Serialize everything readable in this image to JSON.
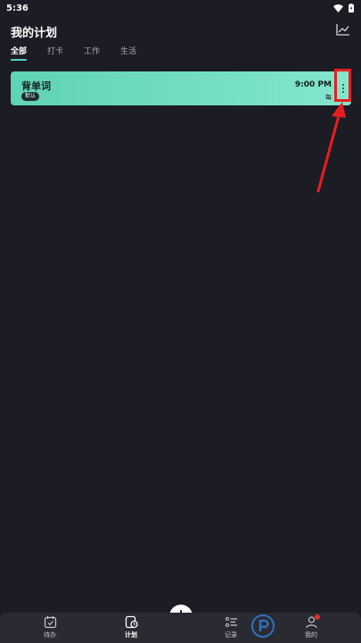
{
  "status_bar": {
    "time": "5:36"
  },
  "header": {
    "title": "我的计划"
  },
  "tabs": [
    {
      "label": "全部",
      "active": true
    },
    {
      "label": "打卡",
      "active": false
    },
    {
      "label": "工作",
      "active": false
    },
    {
      "label": "生活",
      "active": false
    }
  ],
  "plan": {
    "name": "背单词",
    "tag": "默认",
    "time": "9:00 PM",
    "frequency": "每"
  },
  "bottom_nav": {
    "todo": "待办",
    "plan": "计划",
    "record": "记录",
    "mine": "我的"
  },
  "colors": {
    "accent": "#4fd1c5",
    "card_start": "#5ed3b6",
    "card_end": "#84e6cd",
    "highlight": "#e81e1e"
  }
}
